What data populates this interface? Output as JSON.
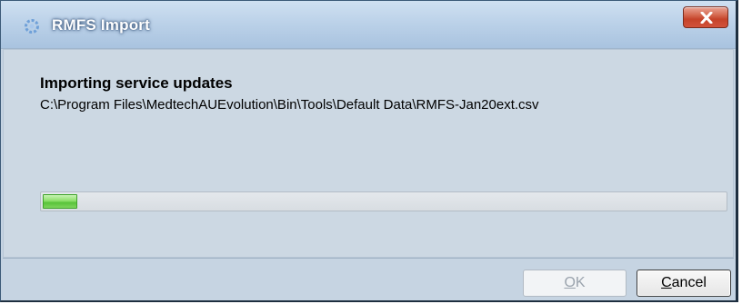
{
  "window": {
    "title": "RMFS Import",
    "close_icon": "close-icon"
  },
  "dialog": {
    "heading": "Importing service updates",
    "file_path": "C:\\Program Files\\MedtechAUEvolution\\Bin\\Tools\\Default Data\\RMFS-Jan20ext.csv",
    "progress_fraction": 0.05
  },
  "buttons": {
    "ok": {
      "mnemonic": "O",
      "rest": "K",
      "enabled": false
    },
    "cancel": {
      "mnemonic": "C",
      "rest": "ancel",
      "enabled": true
    }
  },
  "colors": {
    "progress_fill": "#7fd65d",
    "close_button": "#c5432a"
  }
}
